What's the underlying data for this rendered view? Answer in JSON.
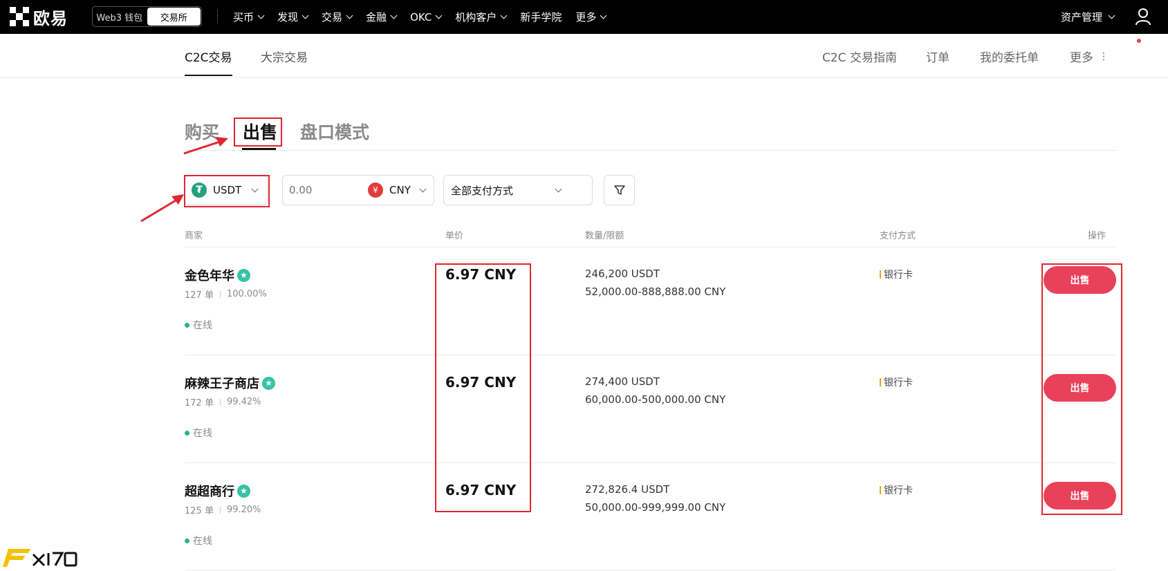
{
  "header": {
    "logo_text": "欧易",
    "mode_switch": [
      "Web3 钱包",
      "交易所"
    ],
    "nav": [
      "买币",
      "发现",
      "交易",
      "金融",
      "OKC",
      "机构客户",
      "新手学院",
      "更多"
    ],
    "asset_mgmt": "资产管理"
  },
  "subnav": {
    "tabs": [
      "C2C交易",
      "大宗交易"
    ],
    "right": [
      "C2C 交易指南",
      "订单",
      "我的委托单",
      "更多"
    ]
  },
  "main_tabs": [
    "购买",
    "出售",
    "盘口模式"
  ],
  "filters": {
    "coin": "USDT",
    "coin_icon": "usdt-tether-icon",
    "amount_placeholder": "0.00",
    "fiat": "CNY",
    "fiat_icon": "cny-yen-icon",
    "payment_method": "全部支付方式"
  },
  "table": {
    "headers": [
      "商家",
      "单价",
      "数量/限额",
      "支付方式",
      "操作"
    ],
    "rows": [
      {
        "merchant": "金色年华",
        "orders": "127 单",
        "completion": "100.00%",
        "status": "在线",
        "price": "6.97 CNY",
        "quantity": "246,200 USDT",
        "limit": "52,000.00-888,888.00 CNY",
        "payment": "银行卡",
        "action": "出售"
      },
      {
        "merchant": "麻辣王子商店",
        "orders": "172 单",
        "completion": "99.42%",
        "status": "在线",
        "price": "6.97 CNY",
        "quantity": "274,400 USDT",
        "limit": "60,000.00-500,000.00 CNY",
        "payment": "银行卡",
        "action": "出售"
      },
      {
        "merchant": "超超商行",
        "orders": "125 单",
        "completion": "99.20%",
        "status": "在线",
        "price": "6.97 CNY",
        "quantity": "272,826.4 USDT",
        "limit": "50,000.00-999,999.00 CNY",
        "payment": "银行卡",
        "action": "出售"
      }
    ]
  },
  "colors": {
    "sell_button": "#e9415a",
    "annotation": "#e0262e",
    "usdt": "#26a17b",
    "online": "#2bb673"
  }
}
